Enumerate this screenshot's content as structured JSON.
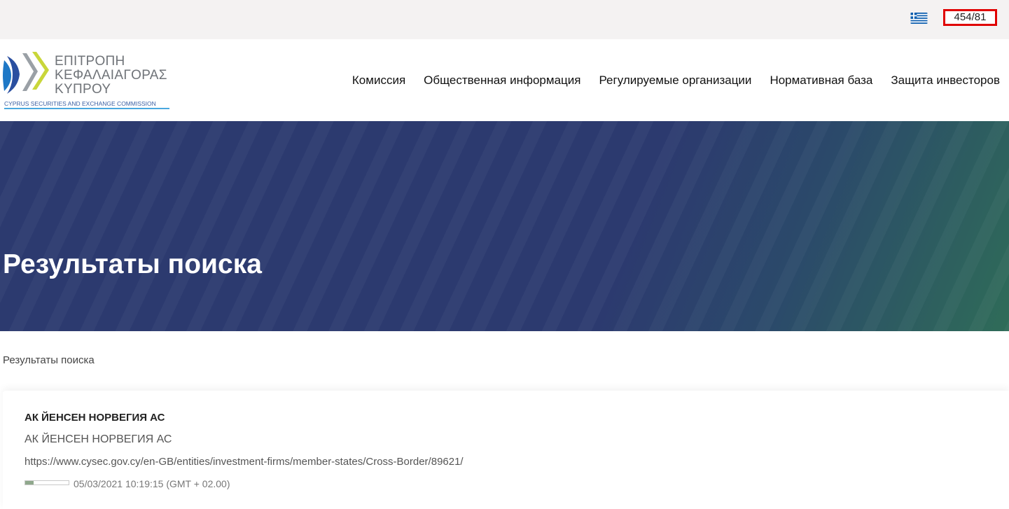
{
  "topbar": {
    "language_flag": "greece-flag-icon",
    "counter": "454/81"
  },
  "logo": {
    "lines": [
      "ΕΠΙΤΡΟΠΗ",
      "ΚΕΦΑΛΑΙΑΓΟΡΑΣ",
      "ΚΥΠΡΟΥ"
    ],
    "subtitle": "CYPRUS SECURITIES AND EXCHANGE COMMISSION"
  },
  "nav": {
    "items": [
      {
        "label": "Комиссия"
      },
      {
        "label": "Общественная информация"
      },
      {
        "label": "Регулируемые организации"
      },
      {
        "label": "Нормативная база"
      },
      {
        "label": "Защита инвесторов"
      }
    ]
  },
  "hero": {
    "title": "Результаты поиска"
  },
  "breadcrumb": "Результаты поиска",
  "results": [
    {
      "title": "АК ЙЕНСЕН НОРВЕГИЯ АС",
      "description": "АК ЙЕНСЕН НОРВЕГИЯ АС",
      "url": "https://www.cysec.gov.cy/en-GB/entities/investment-firms/member-states/Cross-Border/89621/",
      "relevance": 0.2,
      "date": "05/03/2021 10:19:15 (GMT + 02.00)"
    }
  ],
  "colors": {
    "hero_blue": "#2c3a6f",
    "hero_green": "#2f6c58",
    "counter_border": "#e00000",
    "topbar_bg": "#f4f2f2"
  }
}
